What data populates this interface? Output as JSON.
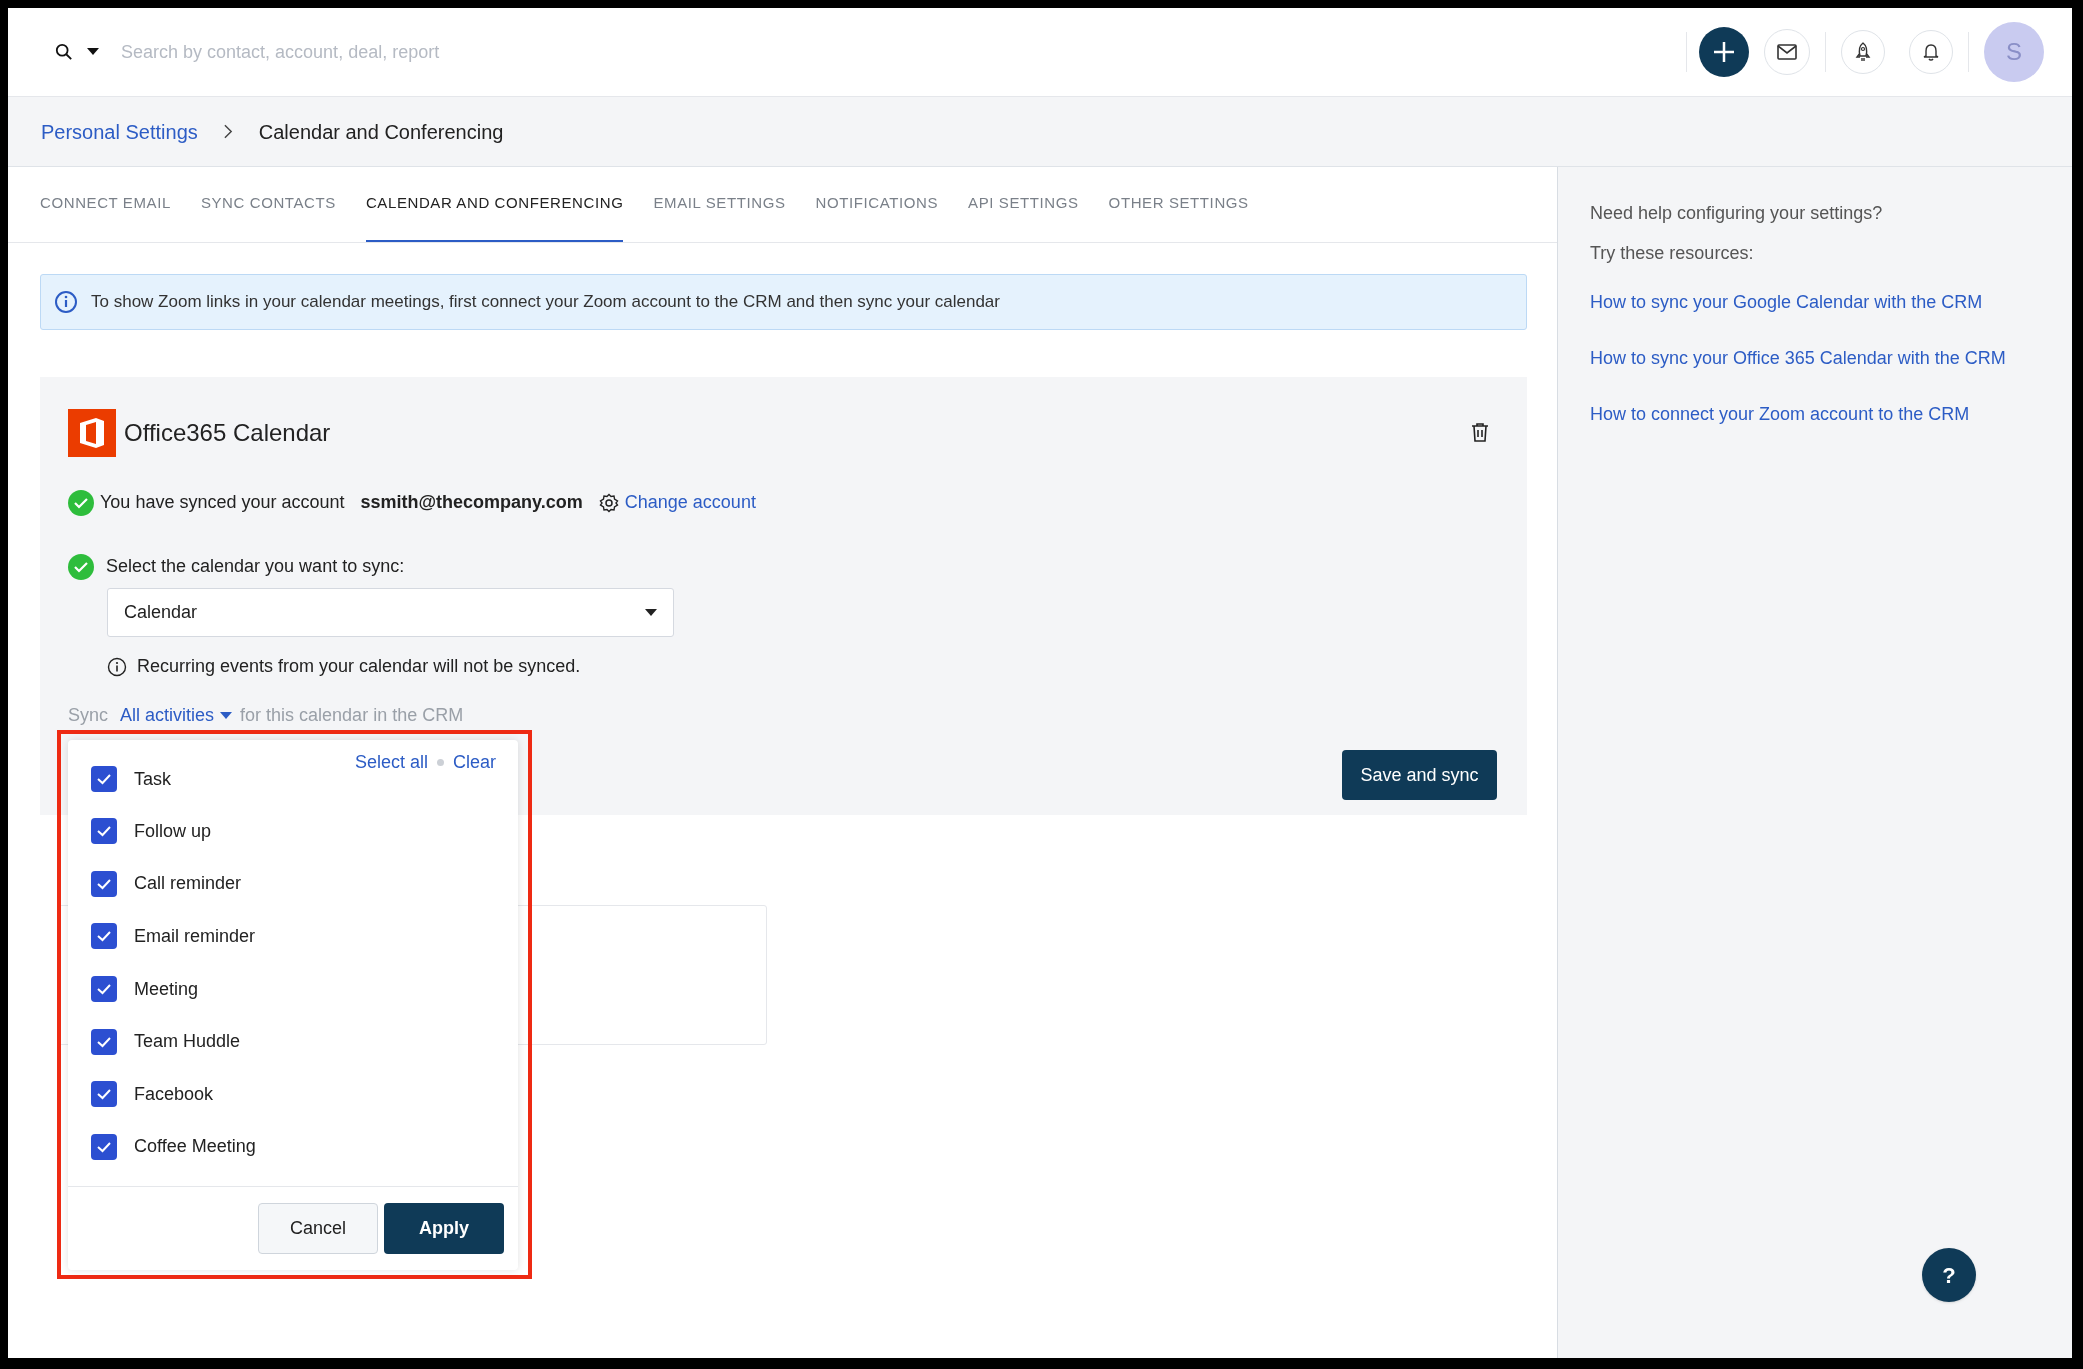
{
  "search": {
    "placeholder": "Search by contact, account, deal, report"
  },
  "avatar": {
    "initial": "S"
  },
  "breadcrumb": [
    {
      "label": "Personal Settings",
      "kind": "link"
    },
    {
      "label": "Calendar and Conferencing",
      "kind": "current"
    }
  ],
  "tabs": [
    {
      "label": "CONNECT EMAIL",
      "selected": false
    },
    {
      "label": "SYNC CONTACTS",
      "selected": false
    },
    {
      "label": "CALENDAR AND CONFERENCING",
      "selected": true
    },
    {
      "label": "EMAIL SETTINGS",
      "selected": false
    },
    {
      "label": "NOTIFICATIONS",
      "selected": false
    },
    {
      "label": "API SETTINGS",
      "selected": false
    },
    {
      "label": "OTHER SETTINGS",
      "selected": false
    }
  ],
  "banner": {
    "text": "To show Zoom links in your calendar meetings, first connect your Zoom account to the CRM and then sync your calendar"
  },
  "calendar_card": {
    "title": "Office365 Calendar",
    "synced_text": "You have synced your account",
    "email": "ssmith@thecompany.com",
    "change_account": "Change account",
    "select_label": "Select the calendar you want to sync:",
    "select_value": "Calendar",
    "recurring_note": "Recurring events from your calendar will not be synced.",
    "sync_prefix": "Sync",
    "sync_link": "All activities",
    "sync_suffix": "for this calendar in the CRM",
    "save_button": "Save and sync"
  },
  "activity_dropdown": {
    "select_all": "Select all",
    "clear": "Clear",
    "items": [
      {
        "label": "Task",
        "checked": true
      },
      {
        "label": "Follow up",
        "checked": true
      },
      {
        "label": "Call reminder",
        "checked": true
      },
      {
        "label": "Email reminder",
        "checked": true
      },
      {
        "label": "Meeting",
        "checked": true
      },
      {
        "label": "Team Huddle",
        "checked": true
      },
      {
        "label": "Facebook",
        "checked": true
      },
      {
        "label": "Coffee Meeting",
        "checked": true
      }
    ],
    "cancel": "Cancel",
    "apply": "Apply"
  },
  "help_panel": {
    "heading": "Need help configuring your settings?",
    "subheading": "Try these resources:",
    "links": [
      "How to sync your Google Calendar with the CRM",
      "How to sync your Office 365 Calendar with the CRM",
      "How to connect your Zoom account to the CRM"
    ]
  },
  "help_button": {
    "label": "?"
  }
}
